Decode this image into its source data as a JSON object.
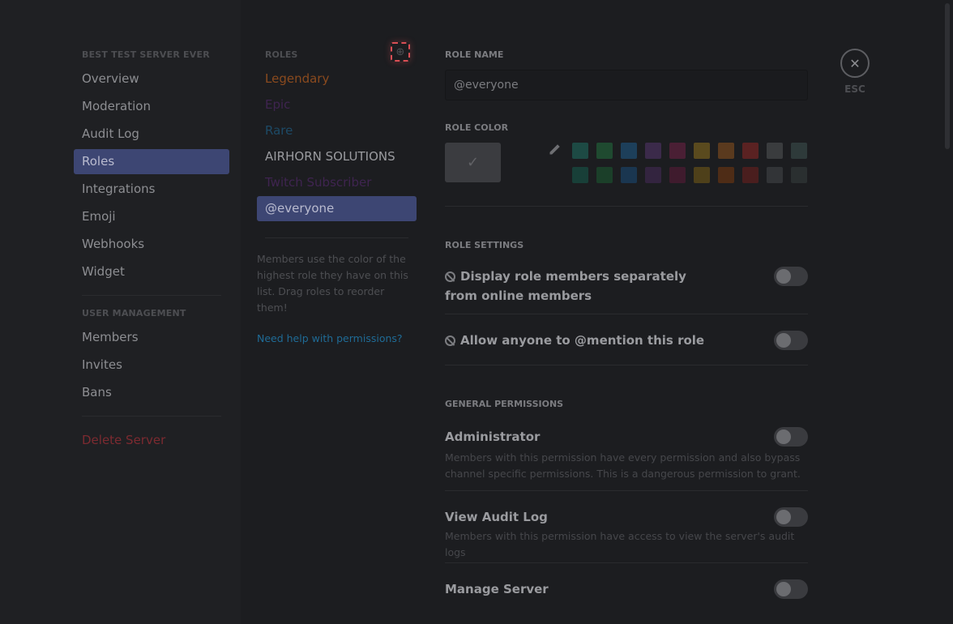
{
  "nav": {
    "server_header": "BEST TEST SERVER EVER",
    "items": [
      "Overview",
      "Moderation",
      "Audit Log",
      "Roles",
      "Integrations",
      "Emoji",
      "Webhooks",
      "Widget"
    ],
    "user_mgmt_header": "USER MANAGEMENT",
    "user_items": [
      "Members",
      "Invites",
      "Bans"
    ],
    "delete_label": "Delete Server"
  },
  "roles": {
    "header": "ROLES",
    "items": [
      {
        "label": "Legendary",
        "color": "#8a4a1e"
      },
      {
        "label": "Epic",
        "color": "#3f2450"
      },
      {
        "label": "Rare",
        "color": "#1d4a66"
      },
      {
        "label": "AIRHORN SOLUTIONS",
        "color": "#9a9b9f"
      },
      {
        "label": "Twitch Subscriber",
        "color": "#3f2450"
      },
      {
        "label": "@everyone",
        "color": "#b9bbcf"
      }
    ],
    "help_text": "Members use the color of the highest role they have on this list. Drag roles to reorder them!",
    "help_link": "Need help with permissions?"
  },
  "main": {
    "role_name_label": "ROLE NAME",
    "role_name_value": "@everyone",
    "role_color_label": "ROLE COLOR",
    "swatches": [
      "#1d4a44",
      "#1f4a30",
      "#1d3f5a",
      "#3b2a4a",
      "#4a1f34",
      "#5a4a1e",
      "#5a3a1e",
      "#5a2222",
      "#3a3c3e",
      "#2e3a3a",
      "#183f38",
      "#1b3f29",
      "#1a3650",
      "#33243f",
      "#3f1b2d",
      "#4e401a",
      "#4e2c16",
      "#4a1e1e",
      "#323437",
      "#2a2f30"
    ],
    "role_settings_label": "ROLE SETTINGS",
    "display_separately": "Display role members separately from online members",
    "allow_mention": "Allow anyone to @mention this role",
    "general_permissions_label": "GENERAL PERMISSIONS",
    "permissions": [
      {
        "title": "Administrator",
        "desc": "Members with this permission have every permission and also bypass channel specific permissions. This is a dangerous permission to grant."
      },
      {
        "title": "View Audit Log",
        "desc": "Members with this permission have access to view the server's audit logs"
      },
      {
        "title": "Manage Server",
        "desc": ""
      }
    ]
  },
  "close": {
    "icon": "close-icon",
    "label": "ESC"
  }
}
